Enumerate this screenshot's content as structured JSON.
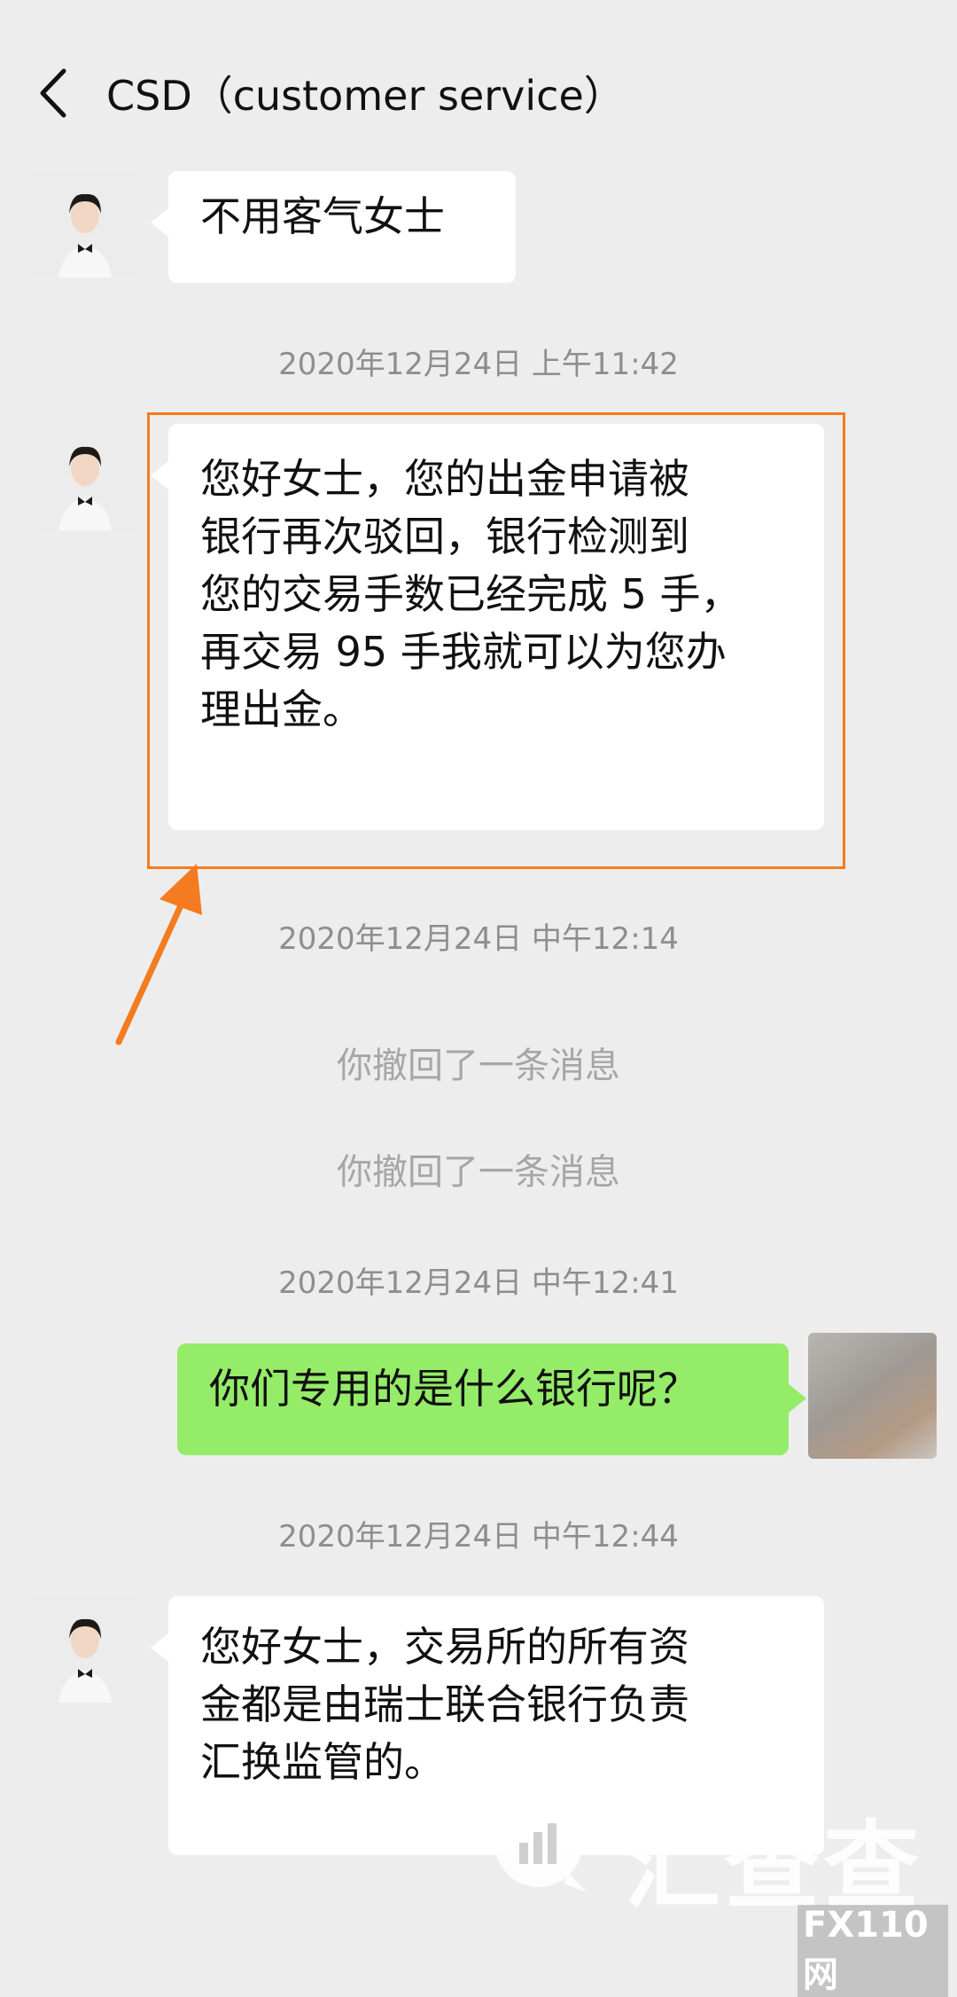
{
  "header": {
    "title": "CSD（customer service）"
  },
  "messages": [
    {
      "side": "left",
      "text": "不用客气女士"
    },
    {
      "side": "left",
      "lines": [
        "您好女士，您的出金申请被",
        "银行再次驳回，银行检测到",
        "您的交易手数已经完成 5 手，",
        "再交易 95 手我就可以为您办",
        "理出金。"
      ]
    },
    {
      "side": "right",
      "text": "你们专用的是什么银行呢？"
    },
    {
      "side": "left",
      "lines": [
        "您好女士，交易所的所有资",
        "金都是由瑞士联合银行负责",
        "汇换监管的。"
      ]
    }
  ],
  "timestamps": [
    "2020年12月24日 上午11:42",
    "2020年12月24日 中午12:14",
    "2020年12月24日 中午12:41",
    "2020年12月24日 中午12:44"
  ],
  "recalls": [
    "你撤回了一条消息",
    "你撤回了一条消息"
  ],
  "watermark": {
    "text": "汇查查",
    "sub": "FX110网"
  },
  "icons": {
    "back": "chevron-left-icon",
    "watermark_logo": "chart-bubble-icon"
  },
  "colors": {
    "background": "#ededed",
    "bubble_in": "#ffffff",
    "bubble_out": "#95ec69",
    "highlight": "#f47b20",
    "timestamp": "#8e8e8e"
  }
}
